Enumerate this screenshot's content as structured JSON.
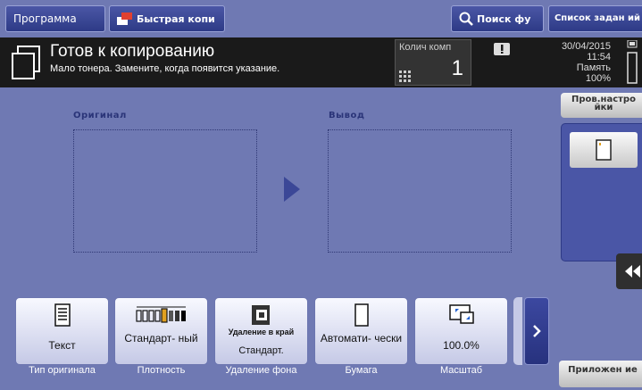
{
  "topbar": {
    "program_label": "Программа",
    "quick_label": "Быстрая копи",
    "search_label": "Поиск фу",
    "joblist_label": "Список задан ий"
  },
  "status": {
    "title": "Готов к копированию",
    "message": "Мало тонера. Замените, когда появится указание.",
    "count_label": "Колич комп",
    "count_value": "1",
    "date": "30/04/2015",
    "time": "11:54",
    "memory_label": "Память",
    "memory_value": "100%"
  },
  "right_panel": {
    "check_settings_label": "Пров.настро йки",
    "apps_label": "Приложен ие"
  },
  "preview": {
    "original_label": "Оригинал",
    "output_label": "Вывод"
  },
  "functions": [
    {
      "icon": "document-text-icon",
      "value": "Текст",
      "name": "Тип оригинала"
    },
    {
      "icon": "density-scale-icon",
      "value": "Стандарт- ный",
      "name": "Плотность"
    },
    {
      "icon": "edge-erase-icon",
      "value_top": "Удаление в край",
      "value": "Стандарт.",
      "name": "Удаление фона"
    },
    {
      "icon": "paper-icon",
      "value": "Автомати- чески",
      "name": "Бумага"
    },
    {
      "icon": "zoom-scale-icon",
      "value": "100.0%",
      "name": "Масштаб"
    }
  ],
  "colors": {
    "background": "#6f79b3",
    "status_bar": "#1a1a1a",
    "button_dark": "#2d3a86"
  }
}
